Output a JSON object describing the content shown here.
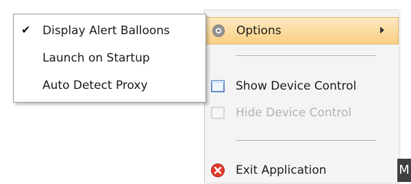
{
  "main_menu": {
    "items": [
      {
        "label": "Options",
        "icon": "gear-icon",
        "highlighted": true,
        "has_submenu": true
      },
      {
        "label": "Show Device Control",
        "icon": "window-icon",
        "enabled": true
      },
      {
        "label": "Hide Device Control",
        "icon": "window-icon",
        "enabled": false
      },
      {
        "label": "Exit Application",
        "icon": "exit-icon",
        "enabled": true
      }
    ]
  },
  "options_submenu": {
    "items": [
      {
        "label": "Display Alert Balloons",
        "checked": true
      },
      {
        "label": "Launch on Startup",
        "checked": false
      },
      {
        "label": "Auto Detect Proxy",
        "checked": false
      }
    ],
    "check_glyph": "✔"
  },
  "badge": {
    "text": "M"
  },
  "colors": {
    "highlight": "#f9cf84",
    "exit_icon": "#e23b2e",
    "disabled_text": "#b3b3b3"
  }
}
